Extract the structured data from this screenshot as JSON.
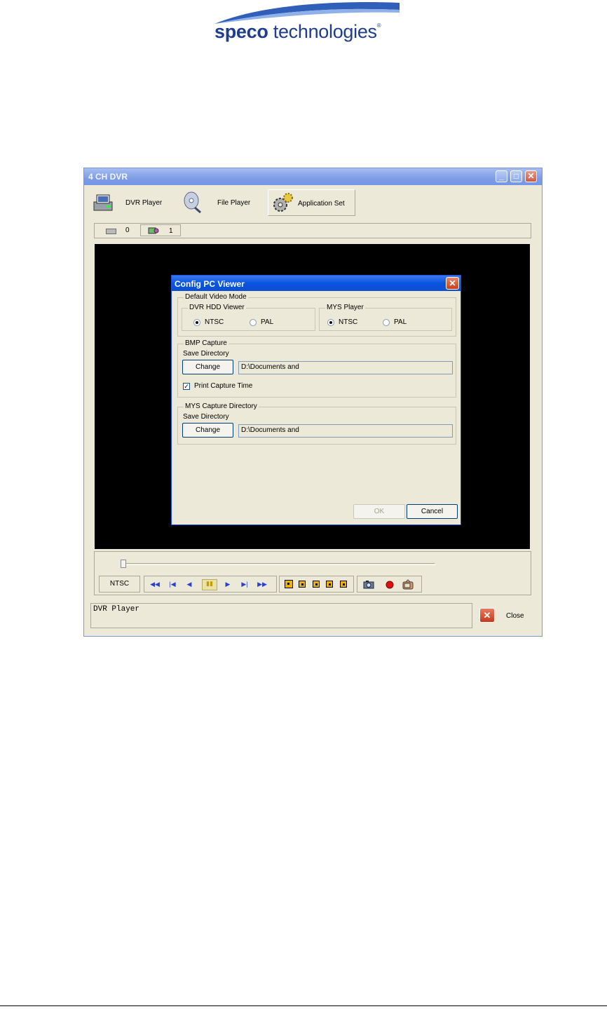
{
  "logo": {
    "brand_bold": "speco",
    "brand_rest": " technologies",
    "reg": "®"
  },
  "colors": {
    "titlebar": "#7e9de6",
    "dialog_title": "#0a54e0",
    "video_bg": "#000000",
    "window_bg": "#ece9d8",
    "close_red": "#c6391a"
  },
  "window": {
    "title": "4 CH DVR",
    "controls": {
      "minimize": "_",
      "maximize": "□",
      "close": "✕"
    },
    "tabs": [
      {
        "label": "DVR Player",
        "icon": "dvr-player-icon"
      },
      {
        "label": "File Player",
        "icon": "file-player-icon"
      },
      {
        "label": "Application Set",
        "icon": "application-set-gear-icon"
      }
    ],
    "counters": {
      "hdd": "0",
      "file": "1"
    }
  },
  "dialog": {
    "title": "Config PC Viewer",
    "close": "✕",
    "default_video_mode": {
      "legend": "Default Video Mode",
      "dvr_hdd_viewer": {
        "legend": "DVR HDD Viewer",
        "options": [
          "NTSC",
          "PAL"
        ],
        "selected": "NTSC"
      },
      "mys_player": {
        "legend": "MYS Player",
        "options": [
          "NTSC",
          "PAL"
        ],
        "selected": "NTSC"
      }
    },
    "bmp_capture": {
      "legend": "BMP Capture",
      "save_label": "Save Directory",
      "change_label": "Change",
      "directory": "D:\\Documents and",
      "print_capture_time_label": "Print Capture Time",
      "print_capture_time_checked": true,
      "check_mark": "✓"
    },
    "mys_capture": {
      "legend": "MYS Capture Directory",
      "save_label": "Save Directory",
      "change_label": "Change",
      "directory": "D:\\Documents and"
    },
    "ok_label": "OK",
    "cancel_label": "Cancel"
  },
  "player": {
    "slider_position": 0.0,
    "video_mode": "NTSC",
    "playback_glyphs": [
      "◀◀",
      "|◀",
      "◀",
      "▮▮",
      "▶",
      "▶|",
      "▶▶"
    ]
  },
  "status": {
    "text": "DVR Player"
  },
  "close_label": "Close",
  "close_glyph": "✕"
}
